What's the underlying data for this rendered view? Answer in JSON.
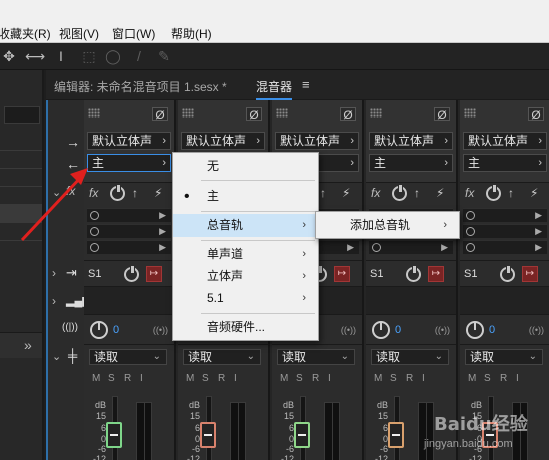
{
  "menubar": {
    "items": [
      "收藏夹(R)",
      "视图(V)",
      "窗口(W)",
      "帮助(H)"
    ]
  },
  "toolbar": {
    "tools": [
      "move-tool-icon",
      "time-selection-icon",
      "text-cursor-icon",
      "marquee-icon",
      "lasso-icon",
      "brush-icon",
      "spot-healing-icon"
    ]
  },
  "panel": {
    "editor_tab": "编辑器: 未命名混音项目 1.sesx *",
    "mixer_tab": "混音器",
    "menu_glyph": "≡"
  },
  "gutter": {
    "io_in": "→",
    "io_out": "←",
    "fx_label": "fx",
    "expand": "›",
    "collapse": "»",
    "fold": "⌄"
  },
  "strips": [
    {
      "input": "默认立体声",
      "output": "主",
      "send": "S1",
      "pan": "0",
      "mode": "读取",
      "fader_color": "#7fd68a"
    },
    {
      "input": "默认立体声",
      "output": "主",
      "send": "S1",
      "pan": "0",
      "mode": "读取",
      "fader_color": "#d8826d"
    },
    {
      "input": "默认立体声",
      "output": "主",
      "send": "S1",
      "pan": "0",
      "mode": "读取",
      "fader_color": "#8fd68a"
    },
    {
      "input": "默认立体声",
      "output": "主",
      "send": "S1",
      "pan": "0",
      "mode": "读取",
      "fader_color": "#d8a06d"
    },
    {
      "input": "默认立体声",
      "output": "主",
      "send": "S1",
      "pan": "0",
      "mode": "读取",
      "fader_color": "#d8826d"
    }
  ],
  "strip_labels": {
    "phase": "Ø",
    "fx": "fx",
    "m": "M",
    "s": "S",
    "r": "R",
    "i": "I",
    "db": "dB",
    "db15": "15",
    "db6": "6",
    "db0": "0",
    "db_6": "-6",
    "db_12": "-12"
  },
  "dropdown": {
    "items": [
      {
        "label": "无",
        "checked": false,
        "submenu": false
      },
      {
        "label": "主",
        "checked": true,
        "submenu": false
      },
      {
        "label": "总音轨",
        "checked": false,
        "submenu": true,
        "highlighted": true
      },
      {
        "label": "单声道",
        "checked": false,
        "submenu": true
      },
      {
        "label": "立体声",
        "checked": false,
        "submenu": true
      },
      {
        "label": "5.1",
        "checked": false,
        "submenu": true
      },
      {
        "label": "音频硬件...",
        "checked": false,
        "submenu": false
      }
    ],
    "check_glyph": "•",
    "arrow_glyph": "›"
  },
  "submenu": {
    "item": "添加总音轨",
    "arrow_glyph": "›"
  },
  "colors": {
    "highlight": "#cce4f7",
    "accent_blue": "#3a8ee6",
    "send_red": "#7a2424",
    "annotation_red": "#e0201e"
  },
  "watermark": {
    "brand": "Baidu经验",
    "url": "jingyan.baidu.com"
  }
}
